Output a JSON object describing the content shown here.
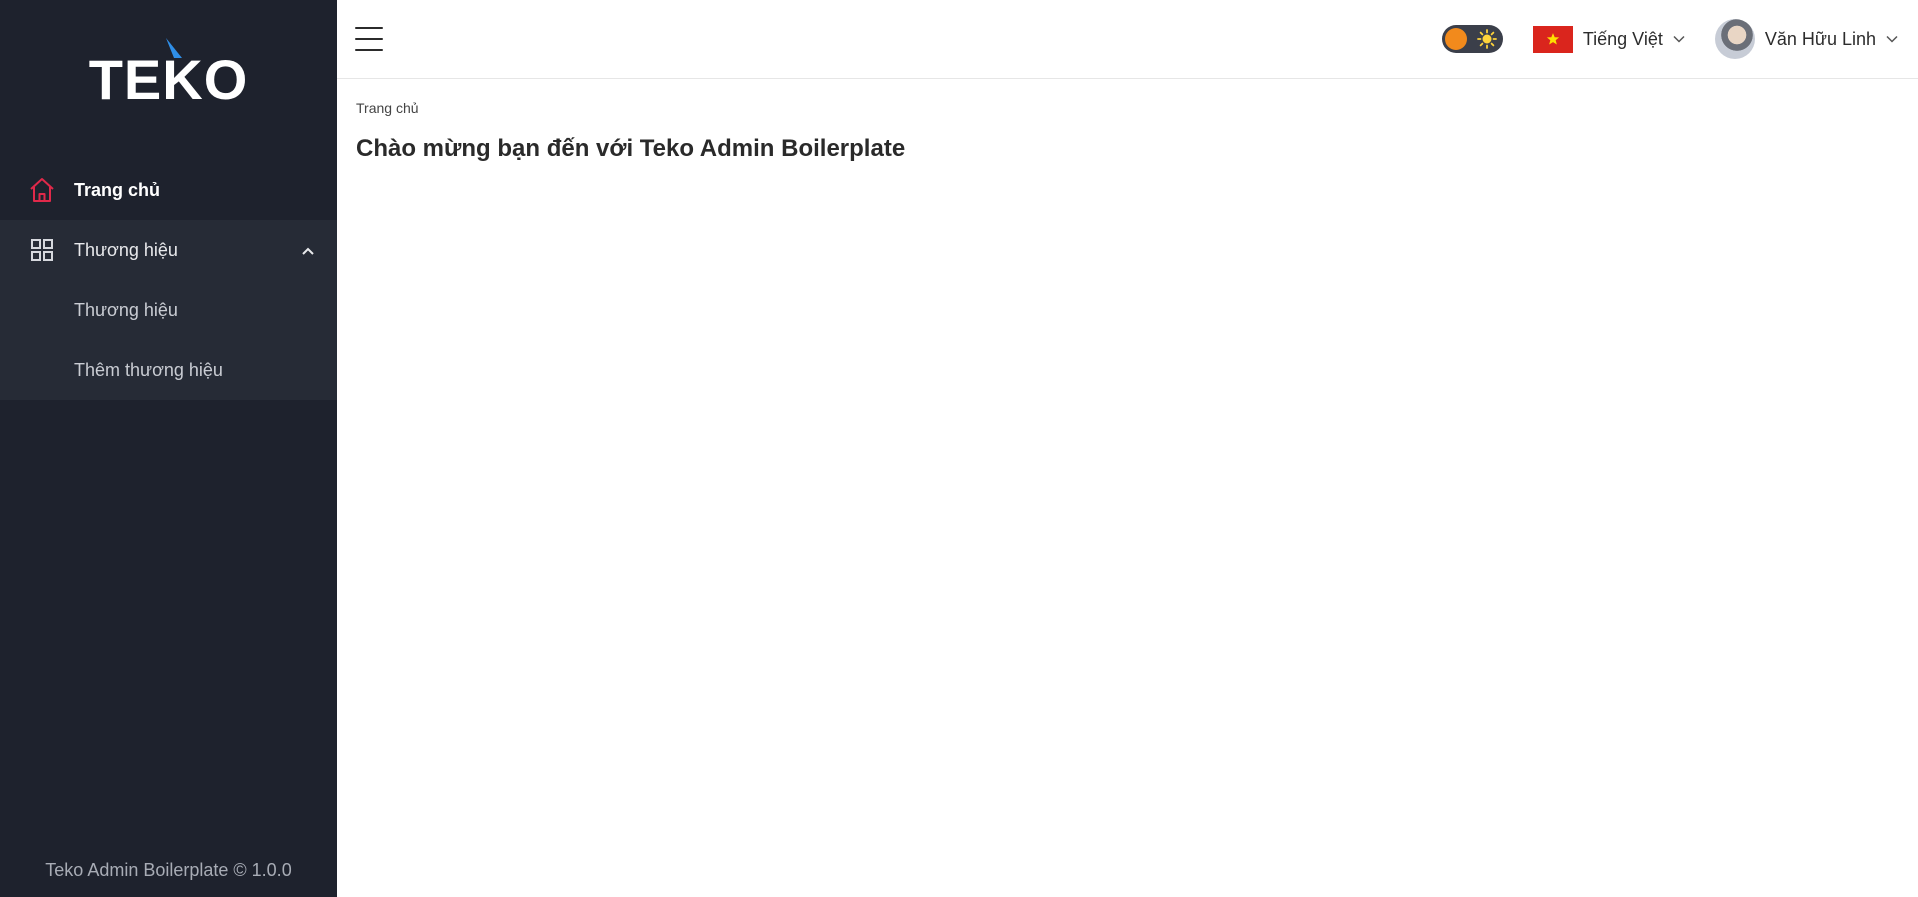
{
  "sidebar": {
    "logo_text": "TEKO",
    "items": [
      {
        "label": "Trang chủ",
        "icon": "home-icon",
        "active": true
      },
      {
        "label": "Thương hiệu",
        "icon": "grid-icon",
        "expanded": true,
        "children": [
          {
            "label": "Thương hiệu"
          },
          {
            "label": "Thêm thương hiệu"
          }
        ]
      }
    ],
    "footer": "Teko Admin Boilerplate © 1.0.0"
  },
  "header": {
    "menu_icon": "hamburger-icon",
    "theme_toggle_icon": "sun-icon",
    "language": {
      "label": "Tiếng Việt",
      "flag": "vietnam-flag-icon"
    },
    "user": {
      "name": "Văn Hữu Linh"
    }
  },
  "content": {
    "breadcrumb": "Trang chủ",
    "title": "Chào mừng bạn đến với Teko Admin Boilerplate"
  },
  "colors": {
    "sidebar_bg": "#1e222d",
    "submenu_bg": "#262b36",
    "accent": "#e0294a",
    "toggle_knob": "#f28a1c",
    "flag_red": "#da251d",
    "flag_star": "#ffde00"
  }
}
